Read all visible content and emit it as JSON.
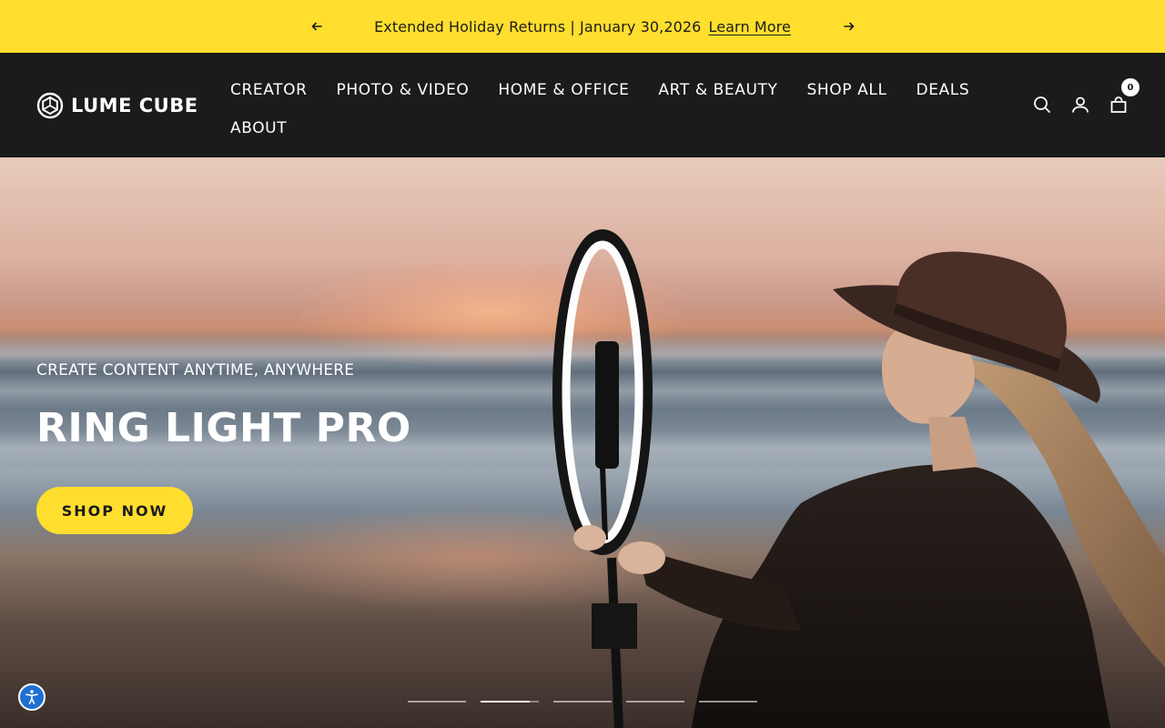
{
  "announcement": {
    "message": "Extended Holiday Returns | January 30,2026",
    "link_label": "Learn More",
    "prev_icon": "arrow-left-icon",
    "next_icon": "arrow-right-icon"
  },
  "header": {
    "logo_text": "LUME CUBE",
    "nav": [
      {
        "label": "CREATOR"
      },
      {
        "label": "PHOTO & VIDEO"
      },
      {
        "label": "HOME & OFFICE"
      },
      {
        "label": "ART & BEAUTY"
      },
      {
        "label": "SHOP ALL"
      },
      {
        "label": "DEALS"
      },
      {
        "label": "ABOUT"
      }
    ],
    "icons": {
      "search": "search-icon",
      "account": "user-icon",
      "cart": "bag-icon"
    },
    "cart_count": "0"
  },
  "hero": {
    "subtitle": "CREATE CONTENT ANYTIME, ANYWHERE",
    "title": "RING LIGHT PRO",
    "cta_label": "SHOP NOW",
    "slides_total": 5,
    "active_slide": 2,
    "active_progress": 0.85
  },
  "accessibility": {
    "icon": "accessibility-icon"
  },
  "colors": {
    "accent": "#ffde2e",
    "header_bg": "#1b1b1b",
    "text_dark": "#1c1c1c",
    "a11y_blue": "#1d6fd1"
  }
}
